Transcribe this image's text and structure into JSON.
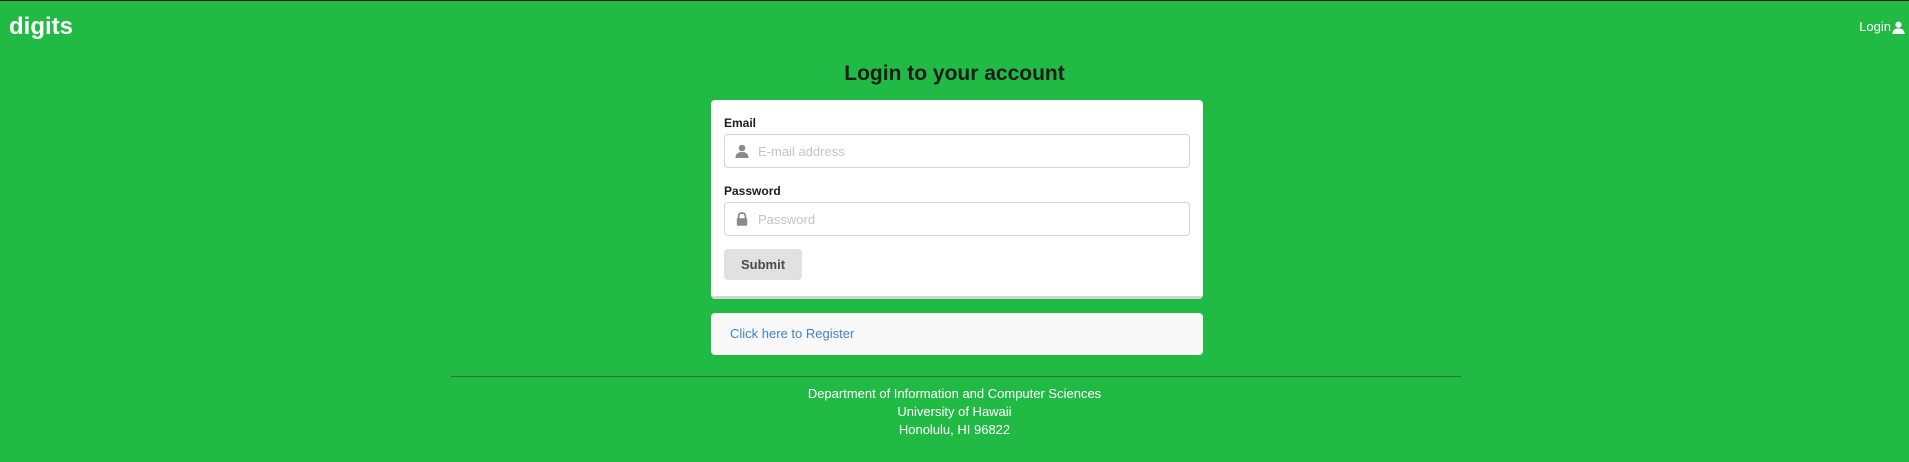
{
  "navbar": {
    "brand": "digits",
    "login_label": "Login",
    "login_icon": "user-icon"
  },
  "page_title": "Login to your account",
  "form": {
    "email": {
      "label": "Email",
      "placeholder": "E-mail address",
      "value": "",
      "icon": "user-icon"
    },
    "password": {
      "label": "Password",
      "placeholder": "Password",
      "value": "",
      "icon": "lock-icon"
    },
    "submit_label": "Submit"
  },
  "register_link": "Click here to Register",
  "footer": {
    "line1": "Department of Information and Computer Sciences",
    "line2": "University of Hawaii",
    "line3": "Honolulu, HI 96822"
  },
  "colors": {
    "background": "#21ba45",
    "link": "#4183c4",
    "button": "#e0e1e2"
  }
}
